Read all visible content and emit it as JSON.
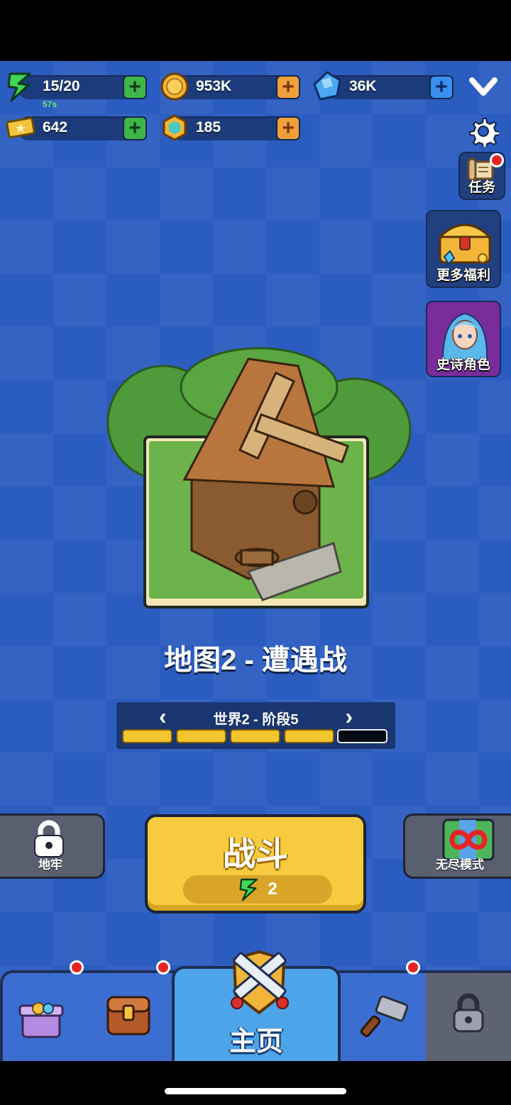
{
  "resources": {
    "energy": {
      "value": "15/20",
      "timer": "57s",
      "icon": "lightning-icon"
    },
    "coins": {
      "value": "953K",
      "icon": "coin-icon"
    },
    "gems": {
      "value": "36K",
      "icon": "gem-icon"
    },
    "tickets": {
      "value": "642",
      "icon": "ticket-icon"
    },
    "hex_tokens": {
      "value": "185",
      "icon": "hex-token-icon"
    }
  },
  "side_menu": {
    "tasks_label": "任务",
    "benefits_label": "更多福利",
    "epic_hero_label": "史诗角色"
  },
  "map": {
    "title": "地图2 - 遭遇战",
    "stage_label": "世界2 - 阶段5",
    "stage_progress": {
      "filled": 4,
      "total": 5
    }
  },
  "modes": {
    "dungeon_label": "地牢",
    "endless_label": "无尽模式"
  },
  "fight": {
    "label": "战斗",
    "cost": "2"
  },
  "nav": {
    "home_label": "主页"
  },
  "colors": {
    "background": "#2b5cc0",
    "fight_button": "#f6cb3f",
    "home_tab": "#4ea4e8",
    "notification": "#e52525"
  }
}
